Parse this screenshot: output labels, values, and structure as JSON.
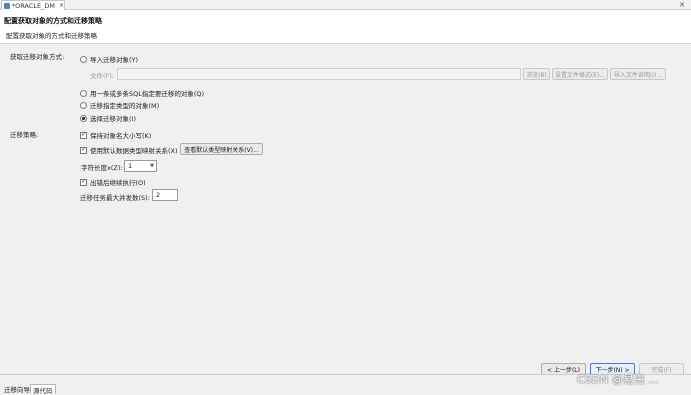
{
  "tab": {
    "title": "*ORACLE_DM",
    "close": "✕"
  },
  "window_close": "✕",
  "header": {
    "title": "配置获取对象的方式和迁移策略",
    "description": "配置获取对象的方式和迁移策略"
  },
  "acquire": {
    "label": "获取迁移对象方式:",
    "import_label": "导入迁移对象(Y)",
    "file_label": "文件(F):",
    "file_value": "",
    "browse_label": "浏览(B)",
    "set_format_label": "设置文件格式(E)...",
    "import_desc_label": "导入文件说明(I)...",
    "sql_label": "用一条或多条SQL指定要迁移的对象(Q)",
    "type_label": "迁移指定类型的对象(M)",
    "select_label": "选择迁移对象(I)",
    "selected_option": "select"
  },
  "strategy": {
    "label": "迁移策略:",
    "keep_case_label": "保持对象名大小写(K)",
    "keep_case_checked": true,
    "default_mapping_label": "使用默认数据类型映射关系(X)",
    "default_mapping_checked": true,
    "view_mapping_label": "查看默认类型映射关系(V)...",
    "char_length_label": "字符长度x(Z):",
    "char_length_value": "1",
    "continue_on_error_label": "出错后继续执行(O)",
    "continue_on_error_checked": true,
    "max_concurrency_label": "迁移任务最大并发数(S):",
    "max_concurrency_value": "2"
  },
  "nav": {
    "back_label": "< 上一步(L)",
    "next_label": "下一步(N) >",
    "finish_label": "完成(F)"
  },
  "bottom_tabs": [
    "迁移向导",
    "源代码"
  ],
  "watermark": "CSDN @易白 ..."
}
